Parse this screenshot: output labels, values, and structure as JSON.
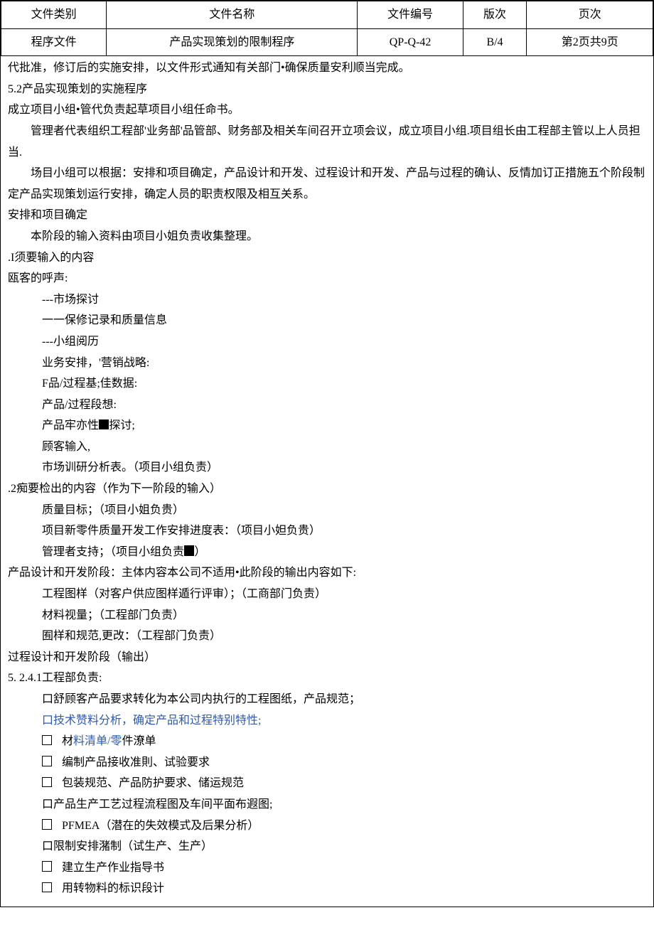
{
  "header": {
    "cols": [
      "文件类别",
      "文件名称",
      "文件编号",
      "版次",
      "页次"
    ],
    "vals": [
      "程序文件",
      "产品实现策划的限制程序",
      "QP-Q-42",
      "B/4",
      "第2页共9页"
    ]
  },
  "body": {
    "p_approve": "代批准，修订后的实施安排，以文件形式通知有关部门•确保质量安利顺当完成。",
    "s52_title": "5.2产品实现策划的实施程序",
    "s52_a": "成立项目小组•管代负责起草项目小组任命书。",
    "s52_b": "管理者代表组织工程部'业务部'品管部、财务部及相关车间召开立项会议，成立项目小组.项目组长由工程部主管以上人员担当.",
    "s52_c": "场目小组可以根据：安排和项目确定，产品设计和开发、过程设计和开发、产品与过程的确认、反情加订正措施五个阶段制定产品实现策划运行安排，确定人员的职责权限及相互关系。",
    "arrange_title": "安排和项目确定",
    "arrange_a": "本阶段的输入资料由项目小姐负责收集整理。",
    "input_title": ".I须要输入的内容",
    "voice_title": "瓯客的呼声:",
    "voice_items": [
      "---市场探讨",
      "一一保修记录和质量信息",
      "---小组阅历",
      "业务安排，'营销战略:",
      "F品/过程基;佳数据:",
      "产品/过程段想:"
    ],
    "voice_reliab_a": "产品牢亦性",
    "voice_reliab_b": "探讨;",
    "voice_cust": "顾客输入,",
    "voice_market": "市场训研分析表。（项目小组负责）",
    "output_title": ".2痴要检出的内容（作为下一阶段的输入）",
    "out_a": "质量目标；（项目小姐负贵）",
    "out_b": "项目新零件质量开发工作安排进度表：（项目小妲负贵）",
    "out_c_a": "管理者支持；（项目小组负责",
    "out_c_b": "）",
    "design_title": "产品设计和开发阶段：主体内容本公司不适用•此阶段的输出内容如下:",
    "design_a": "工程图样（对客户供应图样遁行评审）；（工商部门负责）",
    "design_b": "材料视量；（工程部门负责）",
    "design_c": "囿样和规范,更改：（工程部门负责）",
    "process_title": "过程设计和开发阶段（输出）",
    "s5241_title": "5. 2.4.1工程部负责:",
    "chk_1": "口舒顾客产品要求转化为本公司内执行的工程图纸，产品规范；",
    "chk_2": "口技术赞料分析，确定产品和过程特别特性;",
    "chk_3a": "材",
    "chk_3b": "料清单/零",
    "chk_3c": "件潦单",
    "chk_4": "编制产品接收准則、试验要求",
    "chk_5": "包装规范、产品防护要求、储运规范",
    "chk_6": "口产品生产工艺过程流程图及车间平面布遐图;",
    "chk_7": "PFMEA（潜在的失效模式及后果分析）",
    "chk_8": "口限制安排潴制（试生产、生产）",
    "chk_9": "建立生产作业指导书",
    "chk_10": "用转物料的标识段计"
  }
}
